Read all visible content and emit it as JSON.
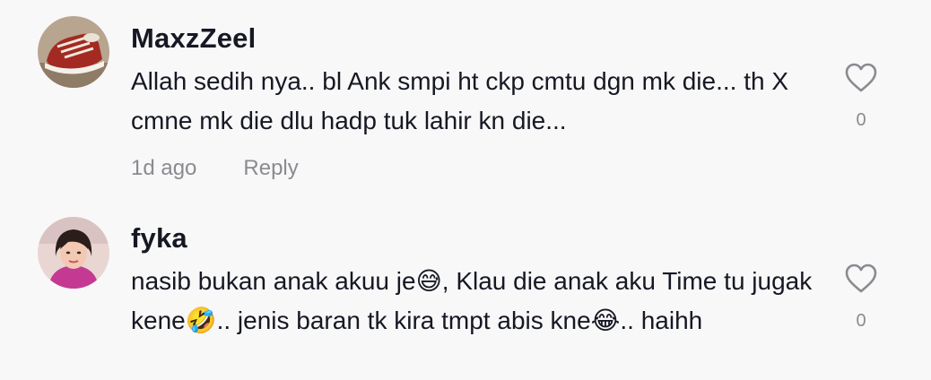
{
  "comments": [
    {
      "username": "MaxzZeel",
      "text": "Allah sedih nya.. bl Ank smpi ht ckp cmtu dgn mk die... th X cmne mk die dlu hadp tuk lahir kn die...",
      "time": "1d ago",
      "reply_label": "Reply",
      "likes": "0",
      "avatar_icon": "sneaker-photo"
    },
    {
      "username": "fyka",
      "text": "nasib bukan anak akuu je😅, Klau die anak aku Time tu jugak kene🤣.. jenis baran tk kira tmpt abis kne😂.. haihh",
      "likes": "0",
      "avatar_icon": "profile-photo"
    }
  ],
  "icons": {
    "like": "heart-outline-icon"
  },
  "colors": {
    "background": "#f8f8f8",
    "username": "#161823",
    "secondary": "#8a8b91"
  }
}
